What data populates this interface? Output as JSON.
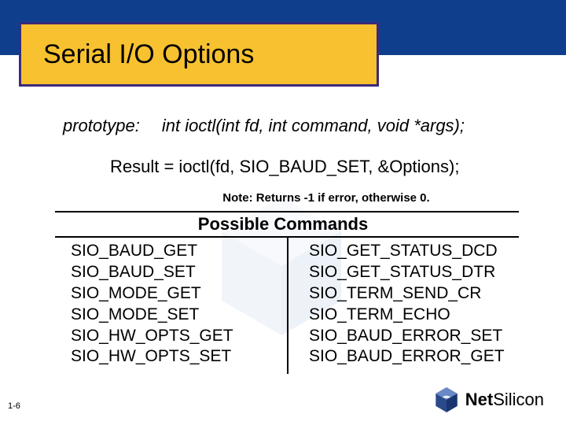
{
  "title": "Serial I/O Options",
  "prototype": {
    "label": "prototype:",
    "signature": "int ioctl(int fd, int command, void *args);"
  },
  "example": "Result = ioctl(fd, SIO_BAUD_SET, &Options);",
  "note": "Note:  Returns -1 if error, otherwise 0.",
  "commands_header": "Possible Commands",
  "commands": {
    "left": [
      "SIO_BAUD_GET",
      "SIO_BAUD_SET",
      "SIO_MODE_GET",
      "SIO_MODE_SET",
      "SIO_HW_OPTS_GET",
      "SIO_HW_OPTS_SET"
    ],
    "right": [
      "SIO_GET_STATUS_DCD",
      "SIO_GET_STATUS_DTR",
      "SIO_TERM_SEND_CR",
      "SIO_TERM_ECHO",
      "SIO_BAUD_ERROR_SET",
      "SIO_BAUD_ERROR_GET"
    ]
  },
  "page_number": "1-6",
  "logo": {
    "net": "Net",
    "silicon": "Silicon"
  }
}
